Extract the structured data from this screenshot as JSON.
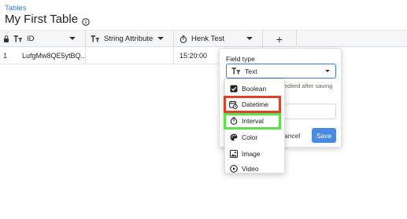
{
  "breadcrumb": "Tables",
  "page_title": "My First Table",
  "grid": {
    "columns": [
      {
        "label": "ID",
        "icon": "text-type-icon"
      },
      {
        "label": "String Attribute",
        "icon": "text-type-icon"
      },
      {
        "label": "Henk Test",
        "icon": "stopwatch-icon"
      },
      {
        "label": "+",
        "icon": "add-column-icon"
      }
    ],
    "rows": [
      {
        "num": "1",
        "id": "LufgMw8QE5ytBQ...",
        "string_attribute": "",
        "henk_test": "15:20:00"
      }
    ]
  },
  "field_panel": {
    "label": "Field type",
    "selected": "Text",
    "hint": "edited after saving",
    "cancel_label": "ancel",
    "save_label": "Save"
  },
  "type_options": [
    {
      "label": "Boolean",
      "icon": "checkbox-icon"
    },
    {
      "label": "Datetime",
      "icon": "calendar-clock-icon"
    },
    {
      "label": "Interval",
      "icon": "stopwatch-icon"
    },
    {
      "label": "Color",
      "icon": "palette-icon"
    },
    {
      "label": "Image",
      "icon": "image-icon"
    },
    {
      "label": "Video",
      "icon": "play-circle-icon"
    }
  ],
  "colors": {
    "accent": "#3b7bd6",
    "save_button": "#4a89e0",
    "highlight_red": "#d9452a",
    "highlight_green": "#5fe04a"
  }
}
